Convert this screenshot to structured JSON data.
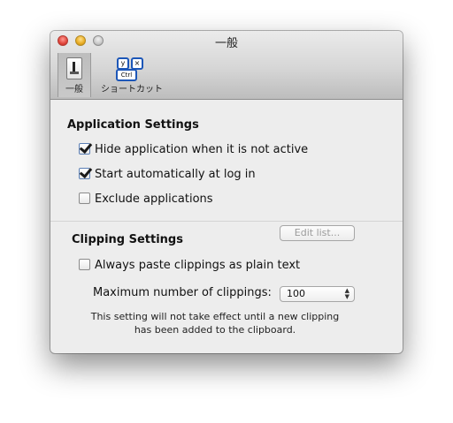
{
  "window": {
    "title": "一般"
  },
  "toolbar": {
    "general_label": "一般",
    "shortcut_label": "ショートカット",
    "shortcut_icon_keys": {
      "key1": "y",
      "key2": "×",
      "key3": "Ctrl"
    }
  },
  "application_settings": {
    "title": "Application Settings",
    "hide_when_inactive": {
      "label": "Hide application when it is not active",
      "checked": true
    },
    "start_at_login": {
      "label": "Start automatically at log in",
      "checked": true
    },
    "exclude_applications": {
      "label": "Exclude applications",
      "checked": false
    },
    "edit_list_button": "Edit list..."
  },
  "clipping_settings": {
    "title": "Clipping Settings",
    "plain_text": {
      "label": "Always paste clippings as plain text",
      "checked": false
    },
    "max_clippings_label": "Maximum number of clippings:",
    "max_clippings_value": "100",
    "note": "This setting will not take effect until a new clipping has been added to the clipboard."
  }
}
